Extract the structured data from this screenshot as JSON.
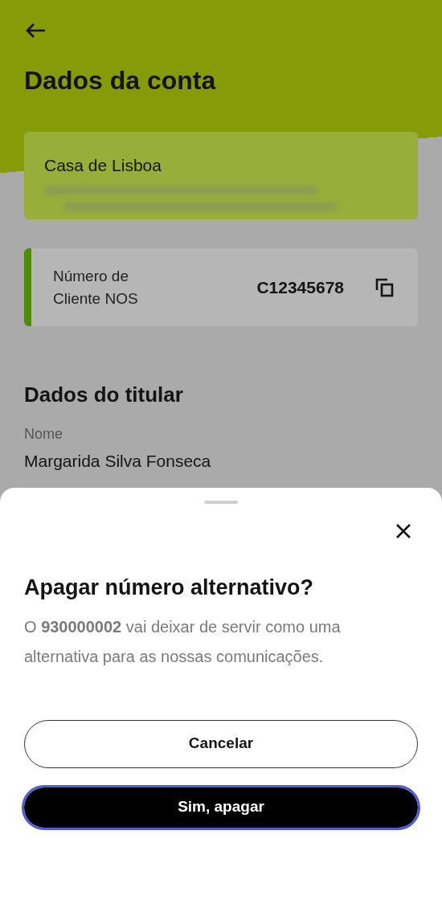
{
  "page": {
    "title": "Dados da conta",
    "account": {
      "name": "Casa de Lisboa"
    },
    "client_number": {
      "label": "Número de Cliente NOS",
      "value": "C12345678"
    },
    "holder": {
      "heading": "Dados do titular",
      "fields": [
        {
          "label": "Nome",
          "value": "Margarida Silva Fonseca"
        }
      ]
    }
  },
  "sheet": {
    "title": "Apagar número alternativo?",
    "body": "O **930000002** vai deixar de servir como uma alternativa para as nossas comunicações.",
    "buttons": [
      {
        "label": "Cancelar",
        "kind": "outline",
        "focused": false
      },
      {
        "label": "Sim, apagar",
        "kind": "filled",
        "focused": true
      }
    ]
  }
}
